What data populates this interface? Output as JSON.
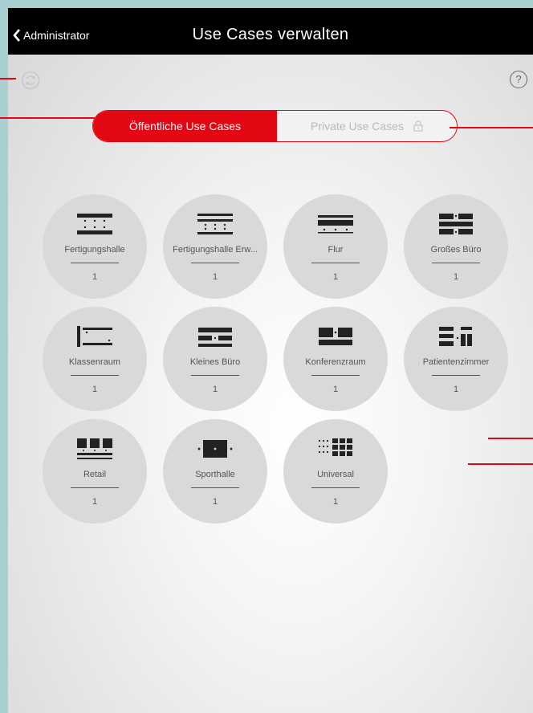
{
  "topbar": {
    "back_label": "Administrator",
    "title": "Use Cases verwalten"
  },
  "icons": {
    "back": "chevron-left-icon",
    "refresh": "refresh-icon",
    "help": "help-icon",
    "lock": "lock-icon"
  },
  "help_symbol": "?",
  "toggle": {
    "public_label": "Öffentliche Use Cases",
    "private_label": "Private Use Cases",
    "selected": "public"
  },
  "use_cases": [
    {
      "label": "Fertigungshalle",
      "count": "1"
    },
    {
      "label": "Fertigungshalle Erw...",
      "count": "1"
    },
    {
      "label": "Flur",
      "count": "1"
    },
    {
      "label": "Großes Büro",
      "count": "1"
    },
    {
      "label": "Klassenraum",
      "count": "1"
    },
    {
      "label": "Kleines Büro",
      "count": "1"
    },
    {
      "label": "Konferenzraum",
      "count": "1"
    },
    {
      "label": "Patientenzimmer",
      "count": "1"
    },
    {
      "label": "Retail",
      "count": "1"
    },
    {
      "label": "Sporthalle",
      "count": "1"
    },
    {
      "label": "Universal",
      "count": "1"
    }
  ],
  "colors": {
    "accent": "#e30613",
    "circle": "#d9d9d9",
    "topbar": "#000000",
    "outer_background": "#a9cfd3"
  }
}
